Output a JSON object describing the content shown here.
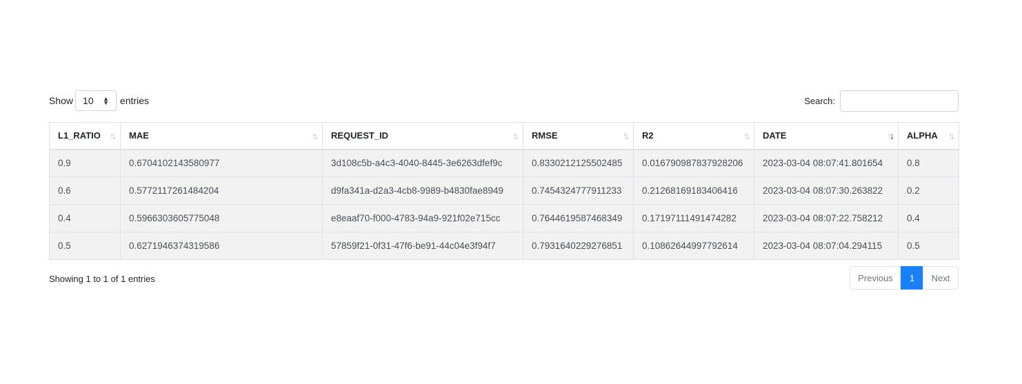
{
  "length_menu": {
    "prefix": "Show",
    "selected": "10",
    "suffix": "entries"
  },
  "search": {
    "label": "Search:",
    "value": ""
  },
  "table": {
    "headers": [
      "L1_RATIO",
      "MAE",
      "REQUEST_ID",
      "RMSE",
      "R2",
      "DATE",
      "ALPHA"
    ],
    "sorted_column": "DATE",
    "sort_direction": "descending",
    "rows": [
      [
        "0.9",
        "0.6704102143580977",
        "3d108c5b-a4c3-4040-8445-3e6263dfef9c",
        "0.8330212125502485",
        "0.016790987837928206",
        "2023-03-04 08:07:41.801654",
        "0.8"
      ],
      [
        "0.6",
        "0.5772117261484204",
        "d9fa341a-d2a3-4cb8-9989-b4830fae8949",
        "0.7454324777911233",
        "0.21268169183406416",
        "2023-03-04 08:07:30.263822",
        "0.2"
      ],
      [
        "0.4",
        "0.5966303605775048",
        "e8eaaf70-f000-4783-94a9-921f02e715cc",
        "0.7644619587468349",
        "0.17197111491474282",
        "2023-03-04 08:07:22.758212",
        "0.4"
      ],
      [
        "0.5",
        "0.6271946374319586",
        "57859f21-0f31-47f6-be91-44c04e3f94f7",
        "0.7931640229276851",
        "0.10862644997792614",
        "2023-03-04 08:07:04.294115",
        "0.5"
      ]
    ]
  },
  "info": "Showing 1 to 1 of 1 entries",
  "pagination": {
    "previous": "Previous",
    "current": "1",
    "next": "Next"
  },
  "colors": {
    "accent": "#1a7ff8",
    "row_bg": "#f2f2f2",
    "border": "#dee2e6"
  }
}
